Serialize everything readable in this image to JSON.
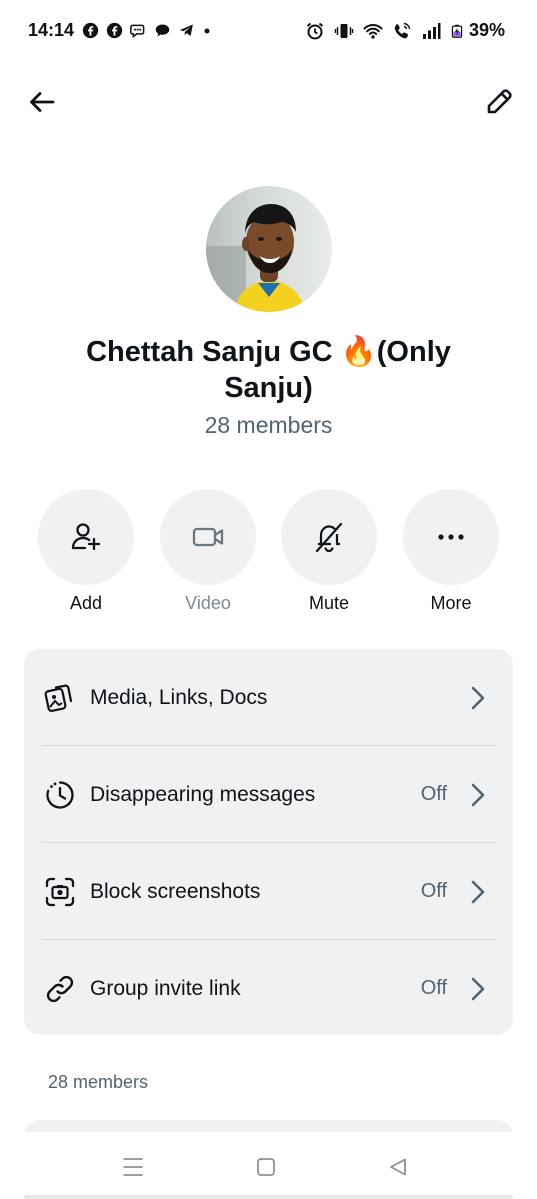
{
  "status_bar": {
    "time": "14:14",
    "battery": "39%",
    "left_icons": [
      "facebook-icon",
      "facebook-icon",
      "messenger-icon",
      "chat-icon",
      "telegram-icon",
      "dot-icon"
    ],
    "right_icons": [
      "alarm-icon",
      "vibrate-icon",
      "wifi-icon",
      "wifi-call-icon",
      "signal-icon",
      "battery-charging-icon"
    ]
  },
  "header": {
    "back_icon": "arrow-left-icon",
    "edit_icon": "pencil-icon"
  },
  "group": {
    "name": "Chettah Sanju GC 🔥(Only Sanju)",
    "members": "28 members"
  },
  "actions": [
    {
      "label": "Add",
      "icon": "add-user-icon",
      "enabled": true
    },
    {
      "label": "Video",
      "icon": "video-camera-icon",
      "enabled": false
    },
    {
      "label": "Mute",
      "icon": "bell-off-icon",
      "enabled": true
    },
    {
      "label": "More",
      "icon": "more-dots-icon",
      "enabled": true
    }
  ],
  "settings": [
    {
      "label": "Media, Links, Docs",
      "value": "",
      "icon": "media-stack-icon"
    },
    {
      "label": "Disappearing messages",
      "value": "Off",
      "icon": "timer-icon"
    },
    {
      "label": "Block screenshots",
      "value": "Off",
      "icon": "screenshot-block-icon"
    },
    {
      "label": "Group invite link",
      "value": "Off",
      "icon": "link-icon"
    }
  ],
  "members_section": {
    "heading": "28 members"
  },
  "colors": {
    "text_primary": "#0f1419",
    "text_secondary": "#536471",
    "card_bg": "#eff1f3",
    "divider": "#cfd9de",
    "jersey_yellow": "#f3d21f"
  }
}
